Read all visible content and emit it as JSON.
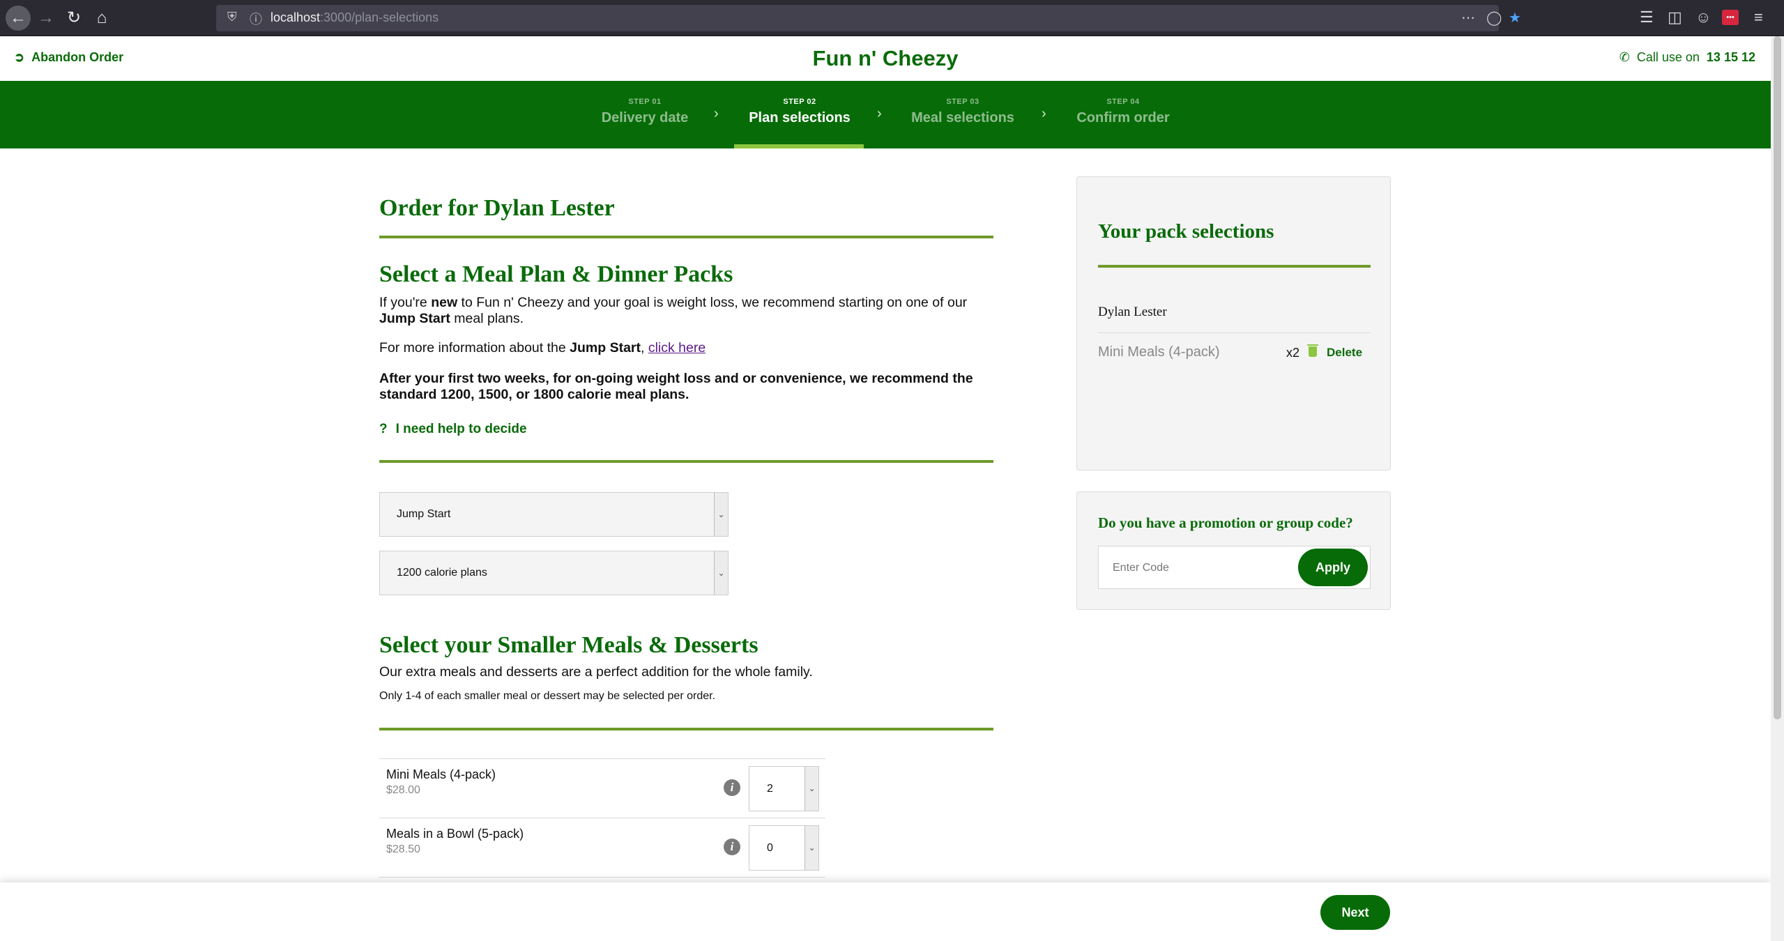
{
  "browser": {
    "url_host": "localhost",
    "url_path": ":3000/plan-selections"
  },
  "header": {
    "abandon_label": "Abandon Order",
    "brand": "Fun n' Cheezy",
    "call_prefix": "Call use on",
    "call_number": "13 15 12"
  },
  "steps": [
    {
      "num": "STEP 01",
      "label": "Delivery date",
      "active": false
    },
    {
      "num": "STEP 02",
      "label": "Plan selections",
      "active": true
    },
    {
      "num": "STEP 03",
      "label": "Meal selections",
      "active": false
    },
    {
      "num": "STEP 04",
      "label": "Confirm order",
      "active": false
    }
  ],
  "main": {
    "order_title": "Order for Dylan Lester",
    "meal_plan_heading": "Select a Meal Plan & Dinner Packs",
    "intro_1": "If you're",
    "intro_new": "new",
    "intro_2": "to Fun n' Cheezy and your goal is weight loss, we recommend starting on one of our",
    "intro_jump": "Jump Start",
    "intro_3": "meal plans.",
    "more_info_1": "For more information about the",
    "more_info_jump": "Jump Start",
    "more_info_link": "click here",
    "recommend": "After your first two weeks, for on-going weight loss and or convenience, we recommend the standard 1200, 1500, or 1800 calorie meal plans.",
    "help_label": "I need help to decide",
    "plan_select": "Jump Start",
    "calorie_select": "1200 calorie plans",
    "smaller_heading": "Select your Smaller Meals & Desserts",
    "smaller_desc": "Our extra meals and desserts are a perfect addition for the whole family.",
    "smaller_note": "Only 1-4 of each smaller meal or dessert may be selected per order.",
    "items": [
      {
        "name": "Mini Meals (4-pack)",
        "price": "$28.00",
        "qty": "2"
      },
      {
        "name": "Meals in a Bowl (5-pack)",
        "price": "$28.50",
        "qty": "0"
      }
    ]
  },
  "pack": {
    "title": "Your pack selections",
    "customer": "Dylan Lester",
    "item_name": "Mini Meals (4-pack)",
    "item_qty": "x2",
    "delete_label": "Delete"
  },
  "promo": {
    "title": "Do you have a promotion or group code?",
    "placeholder": "Enter Code",
    "apply_label": "Apply"
  },
  "footer": {
    "next_label": "Next"
  },
  "colors": {
    "brand_green": "#076c07",
    "accent_green": "#8cc63f",
    "rule_green": "#6e9a2a"
  }
}
